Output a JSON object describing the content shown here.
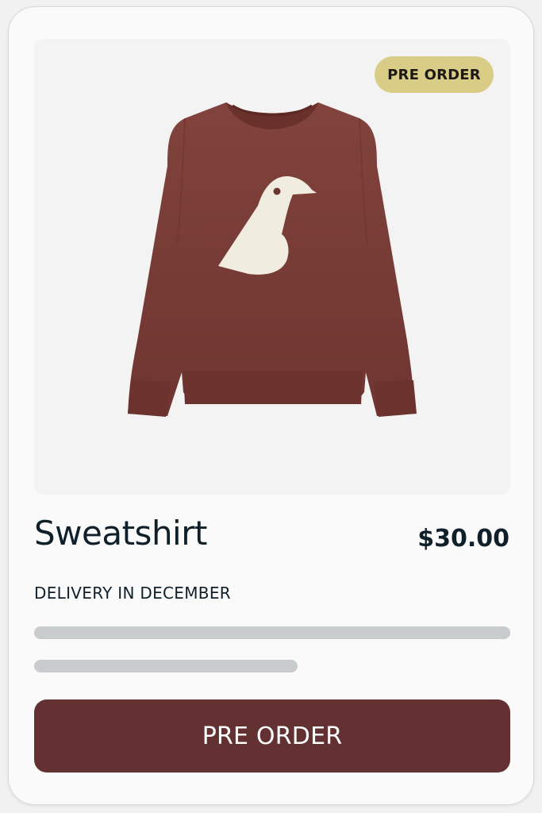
{
  "product": {
    "badge": "PRE ORDER",
    "name": "Sweatshirt",
    "price": "$30.00",
    "delivery": "DELIVERY IN DECEMBER",
    "image_icon": "sweatshirt-image"
  },
  "action": {
    "label": "PRE ORDER"
  },
  "colors": {
    "card_bg": "#fafafa",
    "image_bg": "#f3f3f3",
    "badge_bg": "#d8cc86",
    "sweater": "#7b3d37",
    "bird": "#f1ece0",
    "skeleton": "#c9cccd",
    "button_bg": "#633131",
    "text": "#10202a"
  }
}
